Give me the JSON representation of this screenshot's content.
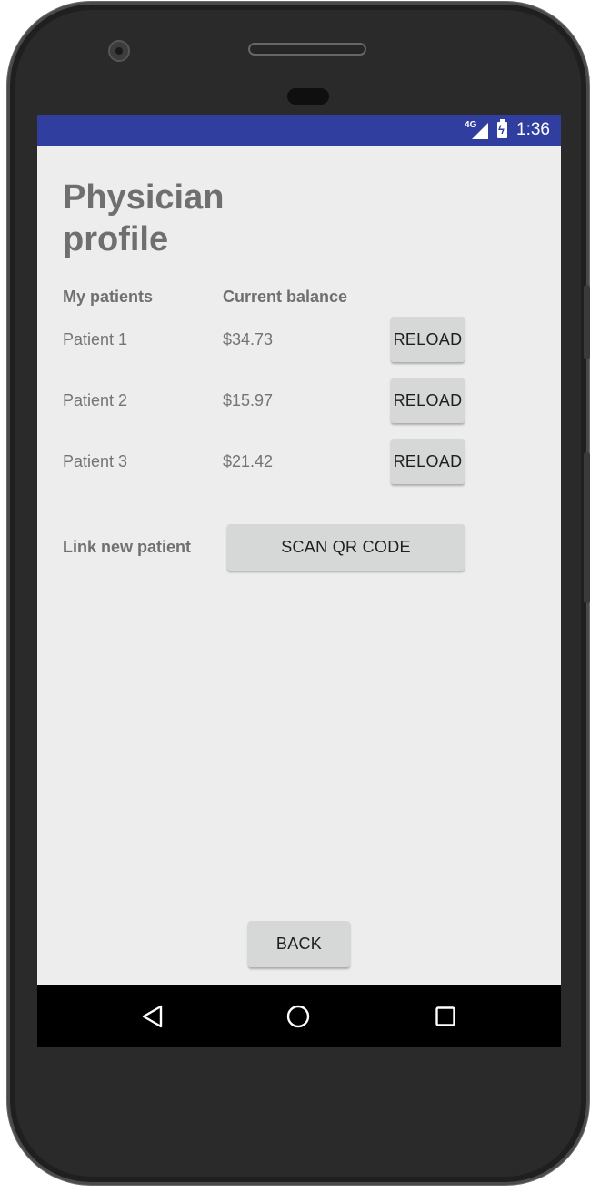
{
  "status_bar": {
    "network": "4G",
    "time": "1:36"
  },
  "page": {
    "title": "Physician profile"
  },
  "table": {
    "headers": {
      "patients": "My patients",
      "balance": "Current balance"
    },
    "rows": [
      {
        "patient": "Patient 1",
        "balance": "$34.73",
        "action": "RELOAD"
      },
      {
        "patient": "Patient 2",
        "balance": "$15.97",
        "action": "RELOAD"
      },
      {
        "patient": "Patient 3",
        "balance": "$21.42",
        "action": "RELOAD"
      }
    ]
  },
  "link": {
    "label": "Link new patient",
    "button": "SCAN QR CODE"
  },
  "footer": {
    "back_label": "BACK"
  },
  "navigation": {
    "back_icon": "triangle-back-icon",
    "home_icon": "circle-home-icon",
    "recents_icon": "square-recents-icon"
  },
  "colors": {
    "status_bar": "#303f9f",
    "screen_background": "#ededed",
    "button_background": "#d6d7d7"
  }
}
